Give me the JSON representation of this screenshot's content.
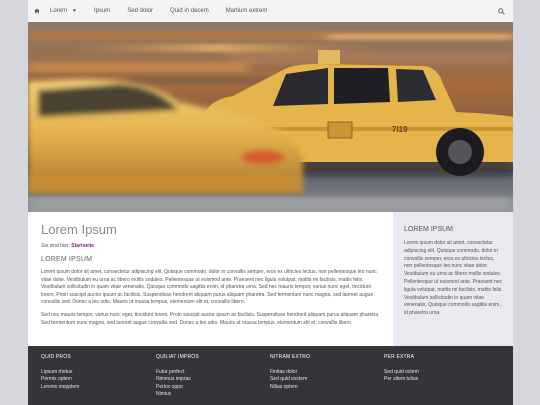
{
  "nav": {
    "items": [
      {
        "label": "Lorem",
        "has_caret": true
      },
      {
        "label": "Ipsum"
      },
      {
        "label": "Sed dolor"
      },
      {
        "label": "Quid in decem"
      },
      {
        "label": "Martium extrem"
      }
    ],
    "icons": {
      "home": "home-icon",
      "search": "search-icon",
      "caret": "caret-down-icon"
    }
  },
  "hero": {
    "image": "taxi-motion-blur-photo"
  },
  "main": {
    "title": "Lorem Ipsum",
    "breadcrumb_prefix": "Sie sind hier:",
    "breadcrumb_link": "Startseite",
    "subtitle": "LOREM IPSUM",
    "paragraph1": "Lorem ipsum dolor sit amet, consectetur adipiscing elit. Quisque commodo, dolor in convallis semper, eros ex ultricies lectus, non pellentesque leo nunc vitae dolor. Vestibulum eu urna ac libero mollis sodales. Pellentesque ut euismod ante. Praesent nec ligula volutpat, mattis mi facilisis, mattis felis. Vestibulum sollicitudin in quam vitae venenatis. Quisque commodo sagittis enim, id pharetra urna. Sed nec mauris tempor, varius nunc eget, tincidunt lorem. Proin suscipit auctor ipsum ac facilisis. Suspendisse hendrerit aliquam purus aliquam pharetra. Sed fermentum nunc magna, sed laoreet augue convallis sed. Donec a leo odio. Mauris ut massa tempus, elementum elit et, convallis libero.",
    "paragraph2": "Sed nec mauris tempor, varius nunc eget, tincidunt lorem. Proin suscipit auctor ipsum ac facilisis. Suspendisse hendrerit aliquam purus aliquam pharetra. Sed fermentum nunc magna, sed laoreet augue convallis sed. Donec a leo odio. Mauris ut massa tempus, elementum elit et, convallis libero."
  },
  "sidebar": {
    "title": "LOREM IPSUM",
    "text": "Lorem ipsum dolor sit amet, consectetur adipiscing elit. Quisque commodo, dolor in convallis semper, eros ex ultricies lectus, non pellentesque leo nunc vitae dolor. Vestibulum eu urna ac libero mollis sodales. Pellentesque ut euismod ante. Praesent nec ligula volutpat, mattis mi facilisis, mattis felis. Vestibulum sollicitudin in quam vitae venenatis. Quisque commodo sagittis enim, id pharetra urna."
  },
  "footer": {
    "columns": [
      {
        "title": "QUID PROS",
        "links": [
          "Lipsum rhetus",
          "Permix optem",
          "Lenmix mepptem"
        ]
      },
      {
        "title": "QUILIAT IMPROS",
        "links": [
          "Futur perfect",
          "Nimmus impras",
          "Perlox oppo",
          "Nimius"
        ]
      },
      {
        "title": "NITRAM EXTRO",
        "links": [
          "Finitas dolor",
          "Sed quid exctem",
          "Nilias optem"
        ]
      },
      {
        "title": "PER EXTRA",
        "links": [
          "Sed quid octem",
          "Per sitem tulius"
        ]
      }
    ]
  },
  "colors": {
    "background": "#d5d7dc",
    "footer": "#34353a",
    "sidebar": "#e8eaef",
    "link": "#7a2b82",
    "taxi": "#e8b84a"
  }
}
